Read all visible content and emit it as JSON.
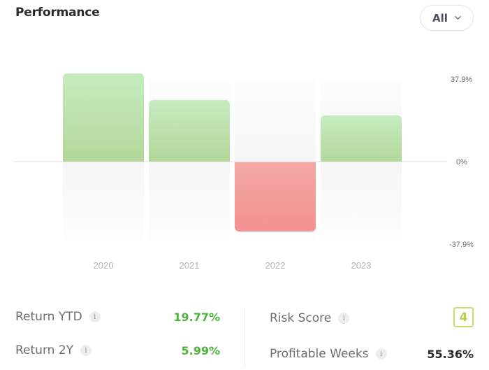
{
  "header": {
    "title": "Performance",
    "filter": {
      "selected": "All",
      "icon": "chevron-down-icon"
    }
  },
  "chart_data": {
    "type": "bar",
    "title": "Performance",
    "categories": [
      "2020",
      "2021",
      "2022",
      "2023"
    ],
    "values": [
      40.5,
      28.3,
      -31.8,
      21.2
    ],
    "unit": "%",
    "ylim": [
      -37.9,
      37.9
    ],
    "yticks": [
      "37.9%",
      "0%",
      "-37.9%"
    ],
    "xlabel": "",
    "ylabel": "",
    "grid": false,
    "zero_line": true,
    "colors": {
      "positive": "#b3d699",
      "positive_top": "#c6ecc1",
      "negative": "#f29292",
      "negative_top": "#f3a8a3"
    }
  },
  "stats": {
    "return_ytd": {
      "label": "Return YTD",
      "value": "19.77%"
    },
    "return_2y": {
      "label": "Return 2Y",
      "value": "5.99%"
    },
    "risk_score": {
      "label": "Risk Score",
      "value": "4"
    },
    "profitable_weeks": {
      "label": "Profitable Weeks",
      "value": "55.36%"
    },
    "info_glyph": "i"
  }
}
